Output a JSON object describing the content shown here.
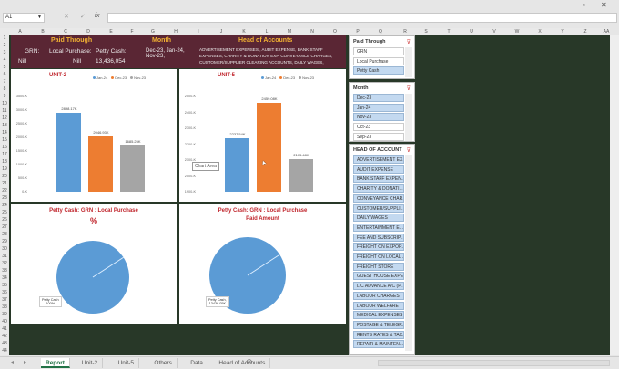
{
  "formula_bar": {
    "name_box": "A1",
    "cancel": "✕",
    "enter": "✓",
    "fx": "fx",
    "value": ""
  },
  "columns": [
    "A",
    "B",
    "C",
    "D",
    "E",
    "F",
    "G",
    "H",
    "I",
    "J",
    "K",
    "L",
    "M",
    "N",
    "O",
    "P",
    "Q",
    "R",
    "S",
    "T",
    "U",
    "V",
    "W",
    "X",
    "Y",
    "Z",
    "AA"
  ],
  "rows_count": 44,
  "header": {
    "paid_through_title": "Paid Through",
    "grn_label": "GRN:",
    "grn_value": "Nill",
    "local_label": "Local Purchase:",
    "local_value": "Nill",
    "petty_label": "Petty Cash:",
    "petty_value": "13,436,054",
    "month_title": "Month",
    "month_value": "Dec-23, Jan-24, Nov-23,",
    "head_title": "Head of Accounts",
    "head_value": "ADVERTISEMENT EXPENSES , AUDIT EXPENSE, BANK STAFF EXPENSES, CHARITY & DONATION EXP, CONVEYANCE CHARGES, CUSTOMER/SUPPLIER CLEARING ACCOUNTS, DAILY WAGES,"
  },
  "chart_data": [
    {
      "type": "bar",
      "title": "UNIT-2",
      "categories": [
        "Jan-24",
        "Dec-23",
        "Nov-23"
      ],
      "values": [
        2898.17,
        2046.93,
        1685.25
      ],
      "labels": [
        "2898.17K",
        "2046.93K",
        "1685.25K"
      ],
      "yticks": [
        "0-K",
        "500-K",
        "1000-K",
        "1500-K",
        "2000-K",
        "2500-K",
        "3000-K",
        "3500-K"
      ],
      "ylim": [
        0,
        3500
      ],
      "colors": [
        "#5b9bd5",
        "#ed7d31",
        "#a5a5a5"
      ]
    },
    {
      "type": "bar",
      "title": "UNIT-5",
      "categories": [
        "Jan-24",
        "Dec-23",
        "Nov-23"
      ],
      "values": [
        2237.54,
        2459.08,
        2105.48
      ],
      "labels": [
        "2237.54K",
        "2459.08K",
        "2105.48K"
      ],
      "yticks": [
        "1900-K",
        "2000-K",
        "2100-K",
        "2200-K",
        "2300-K",
        "2400-K",
        "2500-K"
      ],
      "ylim": [
        1900,
        2500
      ],
      "colors": [
        "#5b9bd5",
        "#ed7d31",
        "#a5a5a5"
      ],
      "tooltip": "Chart Area"
    },
    {
      "type": "pie",
      "title": "Petty Cash: GRN : Local Purchase",
      "subtitle": "%",
      "slices": [
        {
          "name": "Petty Cash",
          "value": 100
        }
      ],
      "label": [
        "Petty Cash",
        "100%"
      ]
    },
    {
      "type": "pie",
      "title": "Petty Cash: GRN : Local Purchase",
      "subtitle": "Paid Amount",
      "slices": [
        {
          "name": "Petty Cash",
          "value": 13436.05
        }
      ],
      "label": [
        "Petty Cash,",
        "13436.05K"
      ]
    }
  ],
  "slicers": {
    "paid_through": {
      "title": "Paid Through",
      "items": [
        {
          "label": "GRN",
          "selected": false
        },
        {
          "label": "Local Purchase",
          "selected": false
        },
        {
          "label": "Petty Cash",
          "selected": true
        }
      ]
    },
    "month": {
      "title": "Month",
      "items": [
        {
          "label": "Dec-23",
          "selected": true
        },
        {
          "label": "Jan-24",
          "selected": true
        },
        {
          "label": "Nov-23",
          "selected": true
        },
        {
          "label": "Oct-23",
          "selected": false
        },
        {
          "label": "Sep-23",
          "selected": false
        }
      ]
    },
    "head": {
      "title": "HEAD OF ACCOUNT",
      "items": [
        "ADVERTISEMENT EX...",
        "AUDIT EXPENSE",
        "BANK STAFF EXPEN...",
        "CHARITY & DONATI...",
        "CONVEYANCE CHAR...",
        "CUSTOMER/SUPPLI...",
        "DAILY WAGES",
        "ENTERTAINMENT E...",
        "FEE AND SUBSCRIP...",
        "FREIGHT ON EXPOR...",
        "FREIGHT ON LOCAL ...",
        "FREIGHT STORE",
        "GUEST HOUSE EXPE...",
        "L.C ADVANCE A/C (P...",
        "LABOUR CHARGES",
        "LABOUR WELFARE",
        "MEDICAL EXPENSES",
        "POSTAGE & TELEGR...",
        "RENTS RATES & TAX...",
        "REPAIR & MAINTEN..."
      ]
    }
  },
  "tabs": [
    {
      "label": "Report",
      "active": true
    },
    {
      "label": "Unit-2"
    },
    {
      "label": "Unit-5"
    },
    {
      "label": "Others"
    },
    {
      "label": "Data"
    },
    {
      "label": "Head of Accounts"
    }
  ]
}
